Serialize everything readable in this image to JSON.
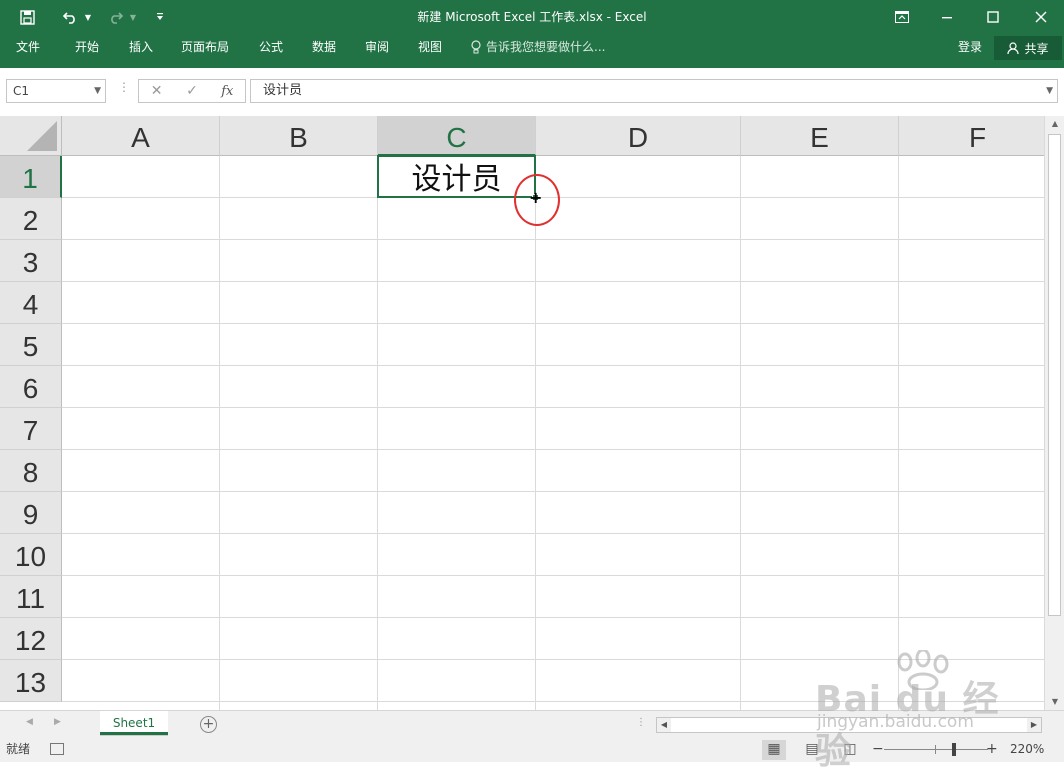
{
  "window": {
    "title": "新建 Microsoft Excel 工作表.xlsx - Excel"
  },
  "ribbon": {
    "tabs": [
      "文件",
      "开始",
      "插入",
      "页面布局",
      "公式",
      "数据",
      "审阅",
      "视图"
    ],
    "tell_me": "告诉我您想要做什么...",
    "login": "登录",
    "share": "共享"
  },
  "formula_bar": {
    "name_box": "C1",
    "content": "设计员"
  },
  "grid": {
    "columns": [
      "A",
      "B",
      "C",
      "D",
      "E",
      "F"
    ],
    "rows": [
      "1",
      "2",
      "3",
      "4",
      "5",
      "6",
      "7",
      "8",
      "9",
      "10",
      "11",
      "12",
      "13"
    ],
    "active_column": "C",
    "active_row": "1",
    "cell_c1": "设计员"
  },
  "sheets": {
    "tabs": [
      "Sheet1"
    ],
    "active": "Sheet1"
  },
  "status": {
    "text": "就绪",
    "zoom": "220%"
  },
  "watermark": {
    "main": "Bai du 经验",
    "sub": "jingyan.baidu.com"
  },
  "colors": {
    "accent": "#217346",
    "annotation": "#e03030"
  }
}
